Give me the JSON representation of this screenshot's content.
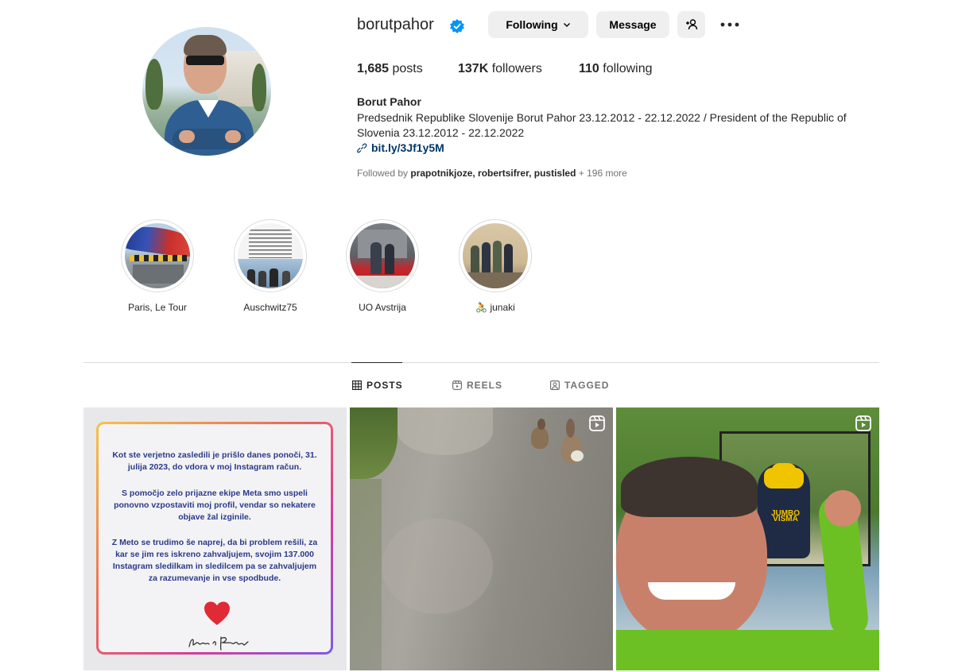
{
  "profile": {
    "username": "borutpahor",
    "verified": true,
    "buttons": {
      "following": "Following",
      "message": "Message"
    },
    "stats": {
      "posts_count": "1,685",
      "posts_label": "posts",
      "followers_count": "137K",
      "followers_label": "followers",
      "following_count": "110",
      "following_label": "following"
    },
    "full_name": "Borut Pahor",
    "bio": "Predsednik Republike Slovenije Borut Pahor 23.12.2012 - 22.12.2022 / President of the Republic of Slovenia 23.12.2012 - 22.12.2022",
    "link": "bit.ly/3Jf1y5M",
    "followed_by": {
      "prefix": "Followed by",
      "names": "prapotnikjoze, robertsifrer, pustisled",
      "more": "+ 196 more"
    }
  },
  "highlights": [
    {
      "label": "Paris, Le Tour"
    },
    {
      "label": "Auschwitz75"
    },
    {
      "label": "UO Avstrija"
    },
    {
      "label": "🚴 junaki"
    }
  ],
  "tabs": [
    {
      "label": "POSTS",
      "icon": "grid-icon",
      "active": true
    },
    {
      "label": "REELS",
      "icon": "reels-icon",
      "active": false
    },
    {
      "label": "TAGGED",
      "icon": "tagged-icon",
      "active": false
    }
  ],
  "posts": {
    "first": {
      "paragraph1": "Kot ste verjetno zasledili je prišlo danes ponoči, 31. julija 2023, do vdora v moj Instagram račun.",
      "paragraph2": "S pomočjo zelo prijazne ekipe Meta smo uspeli ponovno vzpostaviti moj profil, vendar so nekatere objave žal izginile.",
      "paragraph3": "Z Meto se trudimo še naprej, da bi problem rešili, za kar se jim res iskreno zahvaljujem, svojim 137.000 Instagram sledilkam in sledilcem pa se zahvaljujem za razumevanje in vse spodbude."
    },
    "second": {
      "type": "reel"
    },
    "third": {
      "type": "reel",
      "overlay_text": "JUMBO VISMA"
    }
  },
  "colors": {
    "link": "#00376b",
    "verified": "#0095f6",
    "button_bg": "#efefef",
    "text_secondary": "#737373"
  }
}
